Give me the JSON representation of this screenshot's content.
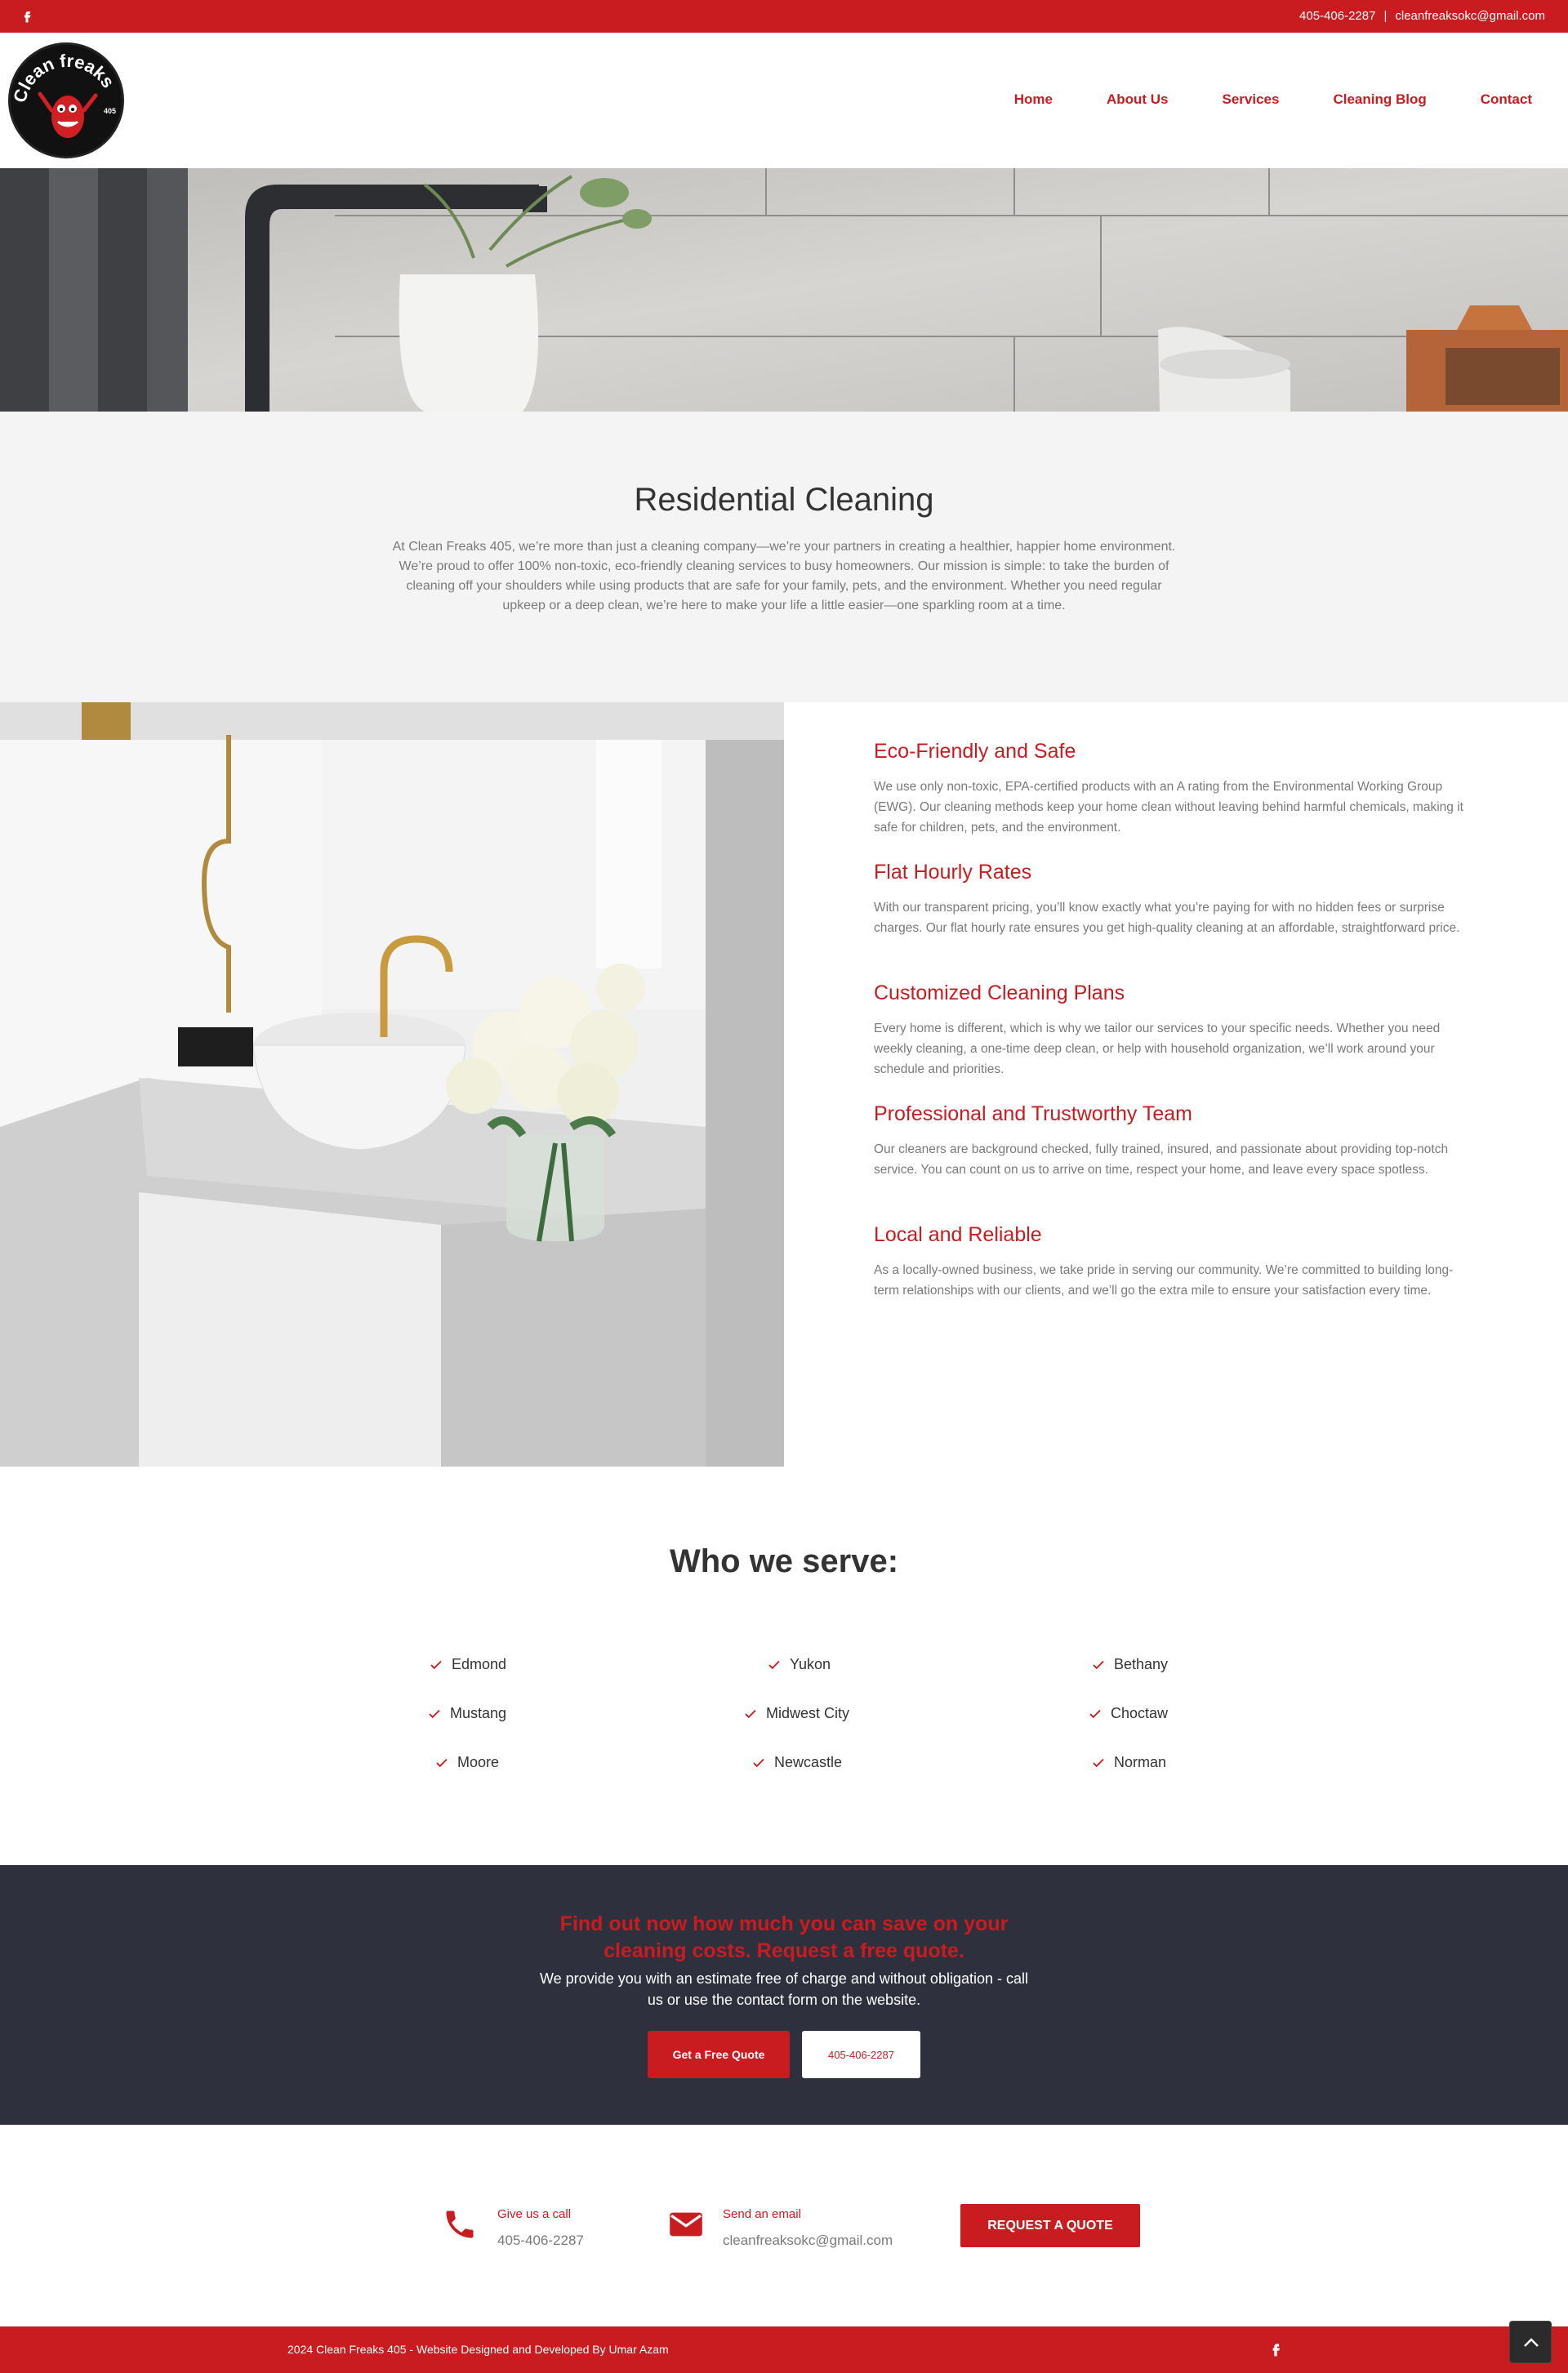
{
  "topbar": {
    "phone": "405-406-2287",
    "separator": "|",
    "email": "cleanfreaksokc@gmail.com",
    "social_icon": "facebook-icon"
  },
  "header": {
    "logo_text": "Clean freaks",
    "logo_sub": "405",
    "nav": [
      "Home",
      "About Us",
      "Services",
      "Cleaning Blog",
      "Contact"
    ]
  },
  "intro": {
    "title": "Residential Cleaning",
    "body": "At Clean Freaks 405, we’re more than just a cleaning company—we’re your partners in creating a healthier, happier home environment. We’re proud to offer 100% non-toxic, eco-friendly cleaning services to busy homeowners. Our mission is simple: to take the burden of cleaning off your shoulders while using products that are safe for your family, pets, and the environment. Whether you need regular upkeep or a deep clean, we’re here to make your life a little easier—one sparkling room at a time."
  },
  "features": [
    {
      "title": "Eco-Friendly and Safe",
      "body": "We use only non-toxic, EPA-certified products with an A rating from the Environmental Working Group (EWG). Our cleaning methods keep your home clean without leaving behind harmful chemicals, making it safe for children, pets, and the environment."
    },
    {
      "title": "Flat Hourly Rates",
      "body": "With our transparent pricing, you’ll know exactly what you’re paying for with no hidden fees or surprise charges. Our flat hourly rate ensures you get high-quality cleaning at an affordable, straightforward price."
    },
    {
      "title": "Customized Cleaning Plans",
      "body": "Every home is different, which is why we tailor our services to your specific needs. Whether you need weekly cleaning, a one-time deep clean, or help with household organization, we’ll work around your schedule and priorities."
    },
    {
      "title": "Professional and Trustworthy Team",
      "body": "Our cleaners are background checked, fully trained, insured, and passionate about providing top-notch service. You can count on us to arrive on time, respect your home, and leave every space spotless."
    },
    {
      "title": "Local and Reliable",
      "body": "As a locally-owned business, we take pride in serving our community. We’re committed to building long-term relationships with our clients, and we’ll go the extra mile to ensure your satisfaction every time."
    }
  ],
  "serve": {
    "title": "Who we serve:",
    "cities": [
      "Edmond",
      "Yukon",
      "Bethany",
      "Mustang",
      "Midwest City",
      "Choctaw",
      "Moore",
      "Newcastle",
      "Norman"
    ]
  },
  "cta": {
    "heading": "Find out now how much you can save on your cleaning costs. Request a free quote.",
    "body": "We provide you with an estimate free of charge and without obligation - call us or use the contact form on the website.",
    "primary_button": "Get a Free Quote",
    "secondary_button": "405-406-2287"
  },
  "contact_strip": {
    "call_label": "Give us a call",
    "call_value": "405-406-2287",
    "call_icon": "phone-icon",
    "email_label": "Send an email",
    "email_value": "cleanfreaksokc@gmail.com",
    "email_icon": "envelope-icon",
    "quote_button": "REQUEST A QUOTE"
  },
  "footer": {
    "copyright": "2024 Clean Freaks 405 - Website Designed and Developed By Umar Azam",
    "social_icon": "facebook-icon",
    "scroll_top_icon": "chevron-up-icon"
  },
  "colors": {
    "brand_red": "#c81c20",
    "dark_band": "#2e313d",
    "intro_bg": "#f4f4f4"
  }
}
